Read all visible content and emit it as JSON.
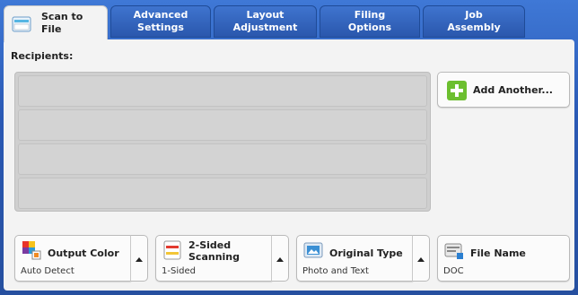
{
  "tabs": [
    {
      "label": "Scan to File",
      "active": true
    },
    {
      "label": "Advanced Settings",
      "active": false
    },
    {
      "label": "Layout Adjustment",
      "active": false
    },
    {
      "label": "Filing Options",
      "active": false
    },
    {
      "label": "Job Assembly",
      "active": false
    }
  ],
  "recipients": {
    "label": "Recipients:",
    "rows": [
      "",
      "",
      "",
      ""
    ]
  },
  "add_another": {
    "label": "Add Another...",
    "icon": "plus-icon"
  },
  "features": [
    {
      "title": "Output Color",
      "value": "Auto Detect",
      "icon": "output-color-icon"
    },
    {
      "title": "2-Sided Scanning",
      "value": "1-Sided",
      "icon": "two-sided-scanning-icon"
    },
    {
      "title": "Original Type",
      "value": "Photo and Text",
      "icon": "original-type-icon"
    },
    {
      "title": "File Name",
      "value": "DOC",
      "icon": "file-name-icon"
    }
  ],
  "colors": {
    "frame": "#2d5aa8",
    "panel": "#f3f3f3",
    "accent_green": "#6cbf2f"
  }
}
